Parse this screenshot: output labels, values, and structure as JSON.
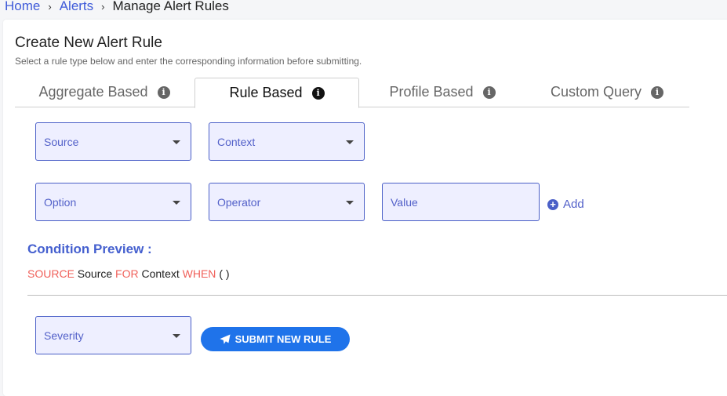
{
  "breadcrumb": {
    "home": "Home",
    "alerts": "Alerts",
    "current": "Manage Alert Rules",
    "separator": "›"
  },
  "header": {
    "title": "Create New Alert Rule",
    "subtitle": "Select a rule type below and enter the corresponding information before submitting."
  },
  "tabs": [
    {
      "label": "Aggregate Based",
      "active": false
    },
    {
      "label": "Rule Based",
      "active": true
    },
    {
      "label": "Profile Based",
      "active": false
    },
    {
      "label": "Custom Query",
      "active": false
    }
  ],
  "form": {
    "source_placeholder": "Source",
    "context_placeholder": "Context",
    "option_placeholder": "Option",
    "operator_placeholder": "Operator",
    "value_placeholder": "Value",
    "add_label": "Add",
    "severity_placeholder": "Severity"
  },
  "preview": {
    "title": "Condition Preview :",
    "kw_source": "SOURCE",
    "source_value": "Source",
    "kw_for": "FOR",
    "context_value": "Context",
    "kw_when": "WHEN",
    "condition": "( )"
  },
  "submit": {
    "label": "SUBMIT NEW RULE"
  },
  "colors": {
    "accent": "#4a5fc7",
    "keyword": "#f0605a",
    "submit": "#1f73ea",
    "field_bg": "#eeefff"
  }
}
